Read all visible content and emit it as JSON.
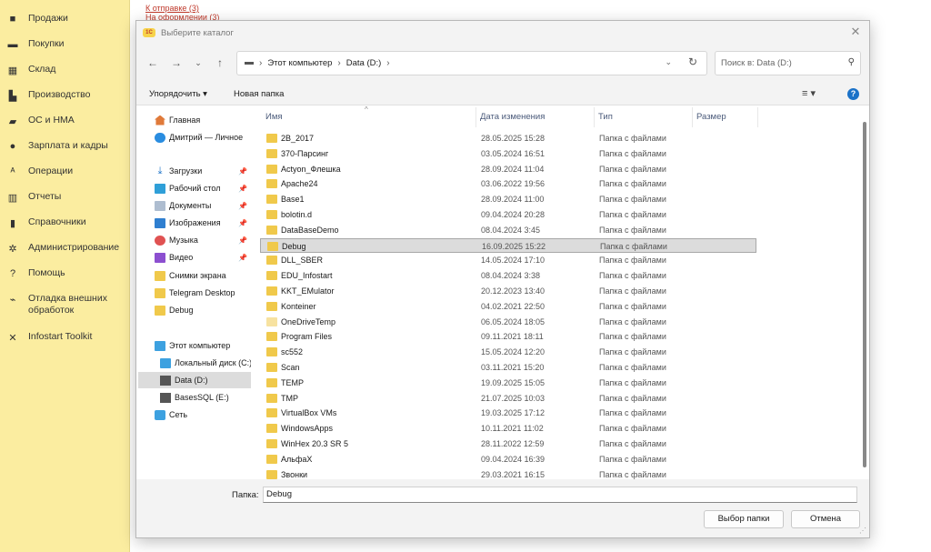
{
  "sidebar": {
    "items": [
      {
        "label": "Продажи",
        "icon": "briefcase-icon"
      },
      {
        "label": "Покупки",
        "icon": "cart-icon"
      },
      {
        "label": "Склад",
        "icon": "warehouse-icon"
      },
      {
        "label": "Производство",
        "icon": "factory-icon"
      },
      {
        "label": "ОС и НМА",
        "icon": "truck-icon"
      },
      {
        "label": "Зарплата и кадры",
        "icon": "person-icon"
      },
      {
        "label": "Операции",
        "icon": "operations-icon"
      },
      {
        "label": "Отчеты",
        "icon": "chart-icon"
      },
      {
        "label": "Справочники",
        "icon": "book-icon"
      },
      {
        "label": "Администрирование",
        "icon": "gear-icon"
      },
      {
        "label": "Помощь",
        "icon": "question-icon"
      },
      {
        "label": "Отладка внешних обработок",
        "icon": "debug-icon"
      },
      {
        "label": "Infostart Toolkit",
        "icon": "tools-icon"
      }
    ]
  },
  "background_links": {
    "to_send": "К отправке (3)",
    "in_process": "На оформлении (3)"
  },
  "dialog": {
    "app_logo": "1С",
    "title": "Выберите каталог",
    "breadcrumb": [
      "Этот компьютер",
      "Data (D:)"
    ],
    "search_placeholder": "Поиск в: Data (D:)",
    "toolbar": {
      "organize": "Упорядочить ▾",
      "new_folder": "Новая папка"
    },
    "tree": [
      {
        "label": "Главная",
        "icon": "home-icon",
        "pinned": false
      },
      {
        "label": "Дмитрий — Личное",
        "icon": "cloud-icon",
        "pinned": false
      },
      {
        "label": "Загрузки",
        "icon": "download-icon",
        "pinned": true
      },
      {
        "label": "Рабочий стол",
        "icon": "desktop-icon",
        "pinned": true
      },
      {
        "label": "Документы",
        "icon": "documents-icon",
        "pinned": true
      },
      {
        "label": "Изображения",
        "icon": "pictures-icon",
        "pinned": true
      },
      {
        "label": "Музыка",
        "icon": "music-icon",
        "pinned": true
      },
      {
        "label": "Видео",
        "icon": "video-icon",
        "pinned": true
      },
      {
        "label": "Снимки экрана",
        "icon": "folder-icon",
        "pinned": false
      },
      {
        "label": "Telegram Desktop",
        "icon": "folder-icon",
        "pinned": false
      },
      {
        "label": "Debug",
        "icon": "folder-icon",
        "pinned": false
      },
      {
        "label": "Этот компьютер",
        "icon": "computer-icon",
        "pinned": false
      },
      {
        "label": "Локальный диск (C:)",
        "icon": "local-disk-icon",
        "pinned": false
      },
      {
        "label": "Data (D:)",
        "icon": "drive-icon",
        "pinned": false,
        "selected": true
      },
      {
        "label": "BasesSQL (E:)",
        "icon": "drive-icon",
        "pinned": false
      },
      {
        "label": "Сеть",
        "icon": "network-icon",
        "pinned": false
      }
    ],
    "columns": {
      "name": "Имя",
      "date": "Дата изменения",
      "type": "Тип",
      "size": "Размер"
    },
    "files": [
      {
        "name": "2B_2017",
        "date": "28.05.2025 15:28",
        "type": "Папка с файлами"
      },
      {
        "name": "370-Парсинг",
        "date": "03.05.2024 16:51",
        "type": "Папка с файлами"
      },
      {
        "name": "Actyon_Флешка",
        "date": "28.09.2024 11:04",
        "type": "Папка с файлами"
      },
      {
        "name": "Apache24",
        "date": "03.06.2022 19:56",
        "type": "Папка с файлами"
      },
      {
        "name": "Base1",
        "date": "28.09.2024 11:00",
        "type": "Папка с файлами"
      },
      {
        "name": "bolotin.d",
        "date": "09.04.2024 20:28",
        "type": "Папка с файлами"
      },
      {
        "name": "DataBaseDemo",
        "date": "08.04.2024 3:45",
        "type": "Папка с файлами"
      },
      {
        "name": "Debug",
        "date": "16.09.2025 15:22",
        "type": "Папка с файлами",
        "selected": true
      },
      {
        "name": "DLL_SBER",
        "date": "14.05.2024 17:10",
        "type": "Папка с файлами"
      },
      {
        "name": "EDU_Infostart",
        "date": "08.04.2024 3:38",
        "type": "Папка с файлами"
      },
      {
        "name": "KKT_EMulator",
        "date": "20.12.2023 13:40",
        "type": "Папка с файлами"
      },
      {
        "name": "Konteiner",
        "date": "04.02.2021 22:50",
        "type": "Папка с файлами"
      },
      {
        "name": "OneDriveTemp",
        "date": "06.05.2024 18:05",
        "type": "Папка с файлами",
        "light": true
      },
      {
        "name": "Program Files",
        "date": "09.11.2021 18:11",
        "type": "Папка с файлами"
      },
      {
        "name": "sc552",
        "date": "15.05.2024 12:20",
        "type": "Папка с файлами"
      },
      {
        "name": "Scan",
        "date": "03.11.2021 15:20",
        "type": "Папка с файлами"
      },
      {
        "name": "TEMP",
        "date": "19.09.2025 15:05",
        "type": "Папка с файлами"
      },
      {
        "name": "TMP",
        "date": "21.07.2025 10:03",
        "type": "Папка с файлами"
      },
      {
        "name": "VirtualBox VMs",
        "date": "19.03.2025 17:12",
        "type": "Папка с файлами"
      },
      {
        "name": "WindowsApps",
        "date": "10.11.2021 11:02",
        "type": "Папка с файлами"
      },
      {
        "name": "WinHex 20.3 SR 5",
        "date": "28.11.2022 12:59",
        "type": "Папка с файлами"
      },
      {
        "name": "АльфаХ",
        "date": "09.04.2024 16:39",
        "type": "Папка с файлами"
      },
      {
        "name": "Звонки",
        "date": "29.03.2021 16:15",
        "type": "Папка с файлами"
      }
    ],
    "folder_label": "Папка:",
    "folder_value": "Debug",
    "select_button": "Выбор папки",
    "cancel_button": "Отмена"
  },
  "colors": {
    "sidebar_bg": "#fbeda0",
    "link_red": "#c0392b",
    "folder_yellow": "#f0c94b",
    "selection_gray": "#dcdcdc",
    "help_blue": "#1b72c8"
  }
}
